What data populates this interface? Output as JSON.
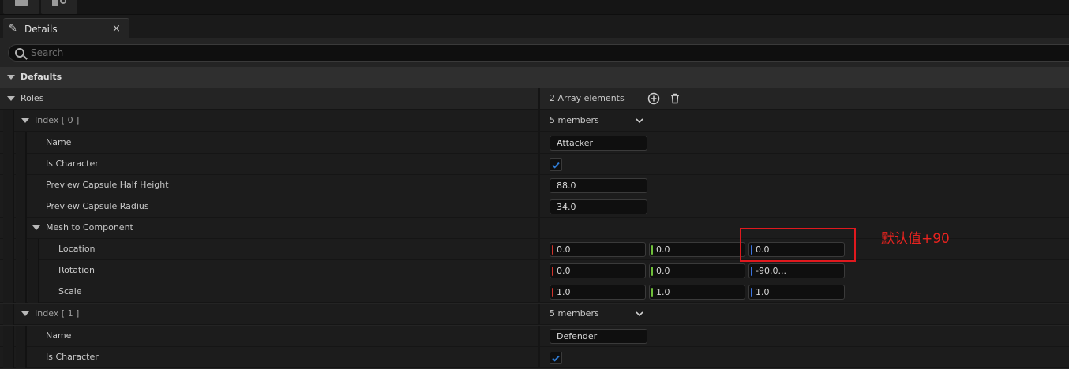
{
  "tab": {
    "label": "Details",
    "close": "×"
  },
  "search": {
    "placeholder": "Search"
  },
  "categories": {
    "defaults": "Defaults"
  },
  "roles": {
    "label": "Roles",
    "count": "2 Array elements",
    "items": [
      {
        "index_label": "Index [ 0 ]",
        "members": "5 members",
        "name_label": "Name",
        "name_value": "Attacker",
        "is_character_label": "Is Character",
        "is_character": true,
        "half_height_label": "Preview Capsule Half Height",
        "half_height": "88.0",
        "radius_label": "Preview Capsule Radius",
        "radius": "34.0",
        "mesh_label": "Mesh to Component",
        "location_label": "Location",
        "location": [
          "0.0",
          "0.0",
          "0.0"
        ],
        "rotation_label": "Rotation",
        "rotation": [
          "0.0",
          "0.0",
          "-90.0..."
        ],
        "scale_label": "Scale",
        "scale": [
          "1.0",
          "1.0",
          "1.0"
        ]
      },
      {
        "index_label": "Index [ 1 ]",
        "members": "5 members",
        "name_label": "Name",
        "name_value": "Defender",
        "is_character_label": "Is Character",
        "is_character": true
      }
    ]
  },
  "annotation": {
    "text": "默认值+90",
    "color": "#e0191e"
  },
  "colors": {
    "axis_x": "#d0342c",
    "axis_y": "#6fbf3a",
    "axis_z": "#3b74e0",
    "check": "#2f7ad1"
  }
}
